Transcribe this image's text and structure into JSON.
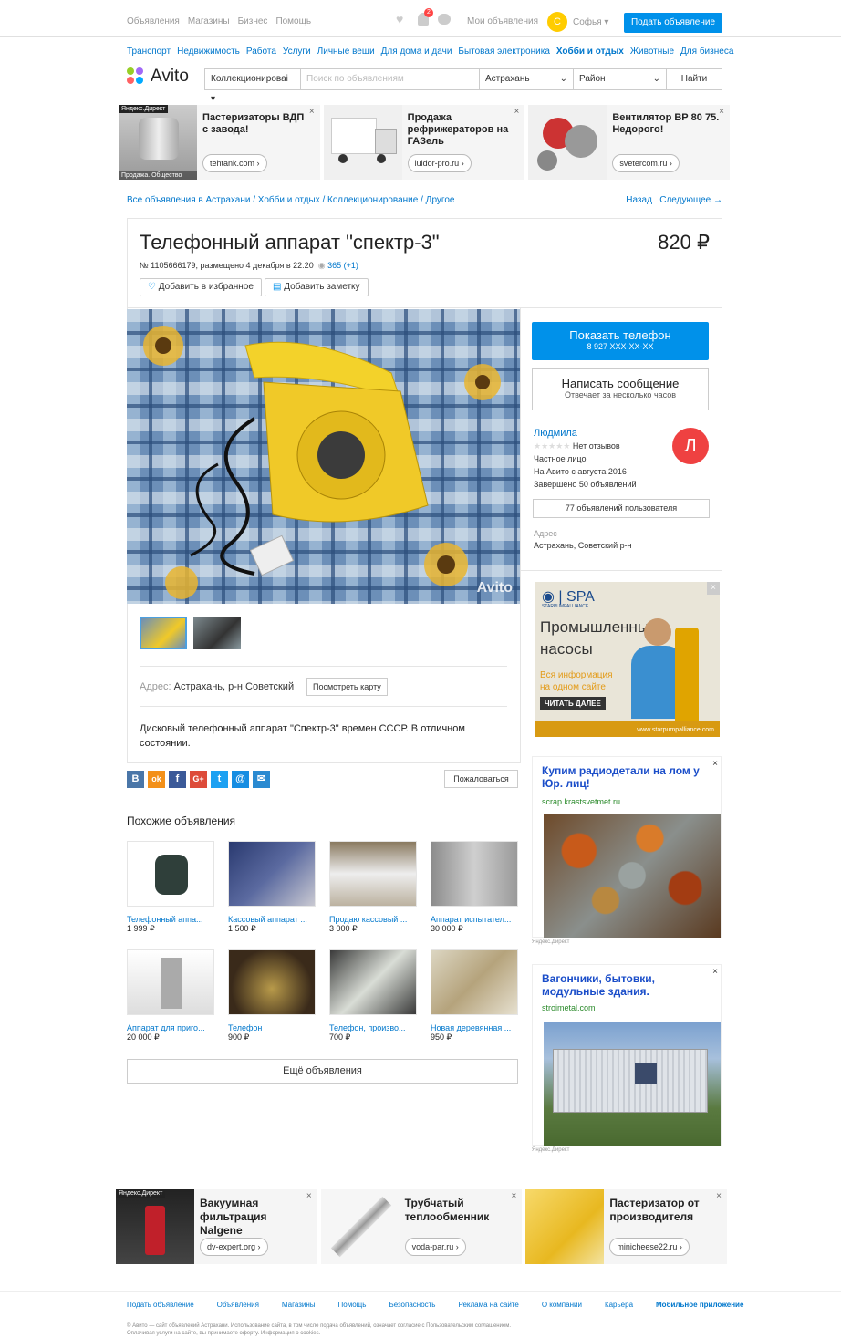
{
  "topbar": {
    "nav": [
      "Объявления",
      "Магазины",
      "Бизнес",
      "Помощь"
    ],
    "notif_count": "2",
    "my_ads": "Мои объявления",
    "user_initial": "С",
    "user_name": "Софья ▾",
    "post_ad": "Подать объявление"
  },
  "categories": [
    "Транспорт",
    "Недвижимость",
    "Работа",
    "Услуги",
    "Личные вещи",
    "Для дома и дачи",
    "Бытовая электроника",
    "Хобби и отдых",
    "Животные",
    "Для бизнеса"
  ],
  "logo": "Avito",
  "search": {
    "category": "Коллекционироваі ▾",
    "placeholder": "Поиск по объявлениям",
    "city": "Астрахань",
    "district": "Район",
    "button": "Найти"
  },
  "ads_top": [
    {
      "title": "Пастеризаторы ВДП с завода!",
      "url": "tehtank.com ›",
      "badge": "Яндекс.Директ",
      "caption": "Продажа. Общество",
      "close": "×"
    },
    {
      "title": "Продажа рефрижераторов на ГАЗель",
      "url": "luidor-pro.ru ›",
      "close": "×"
    },
    {
      "title": "Вентилятор ВР 80 75. Недорого!",
      "url": "svetercom.ru ›",
      "close": "×"
    }
  ],
  "breadcrumb": "Все объявления в Астрахани / Хобби и отдых / Коллекционирование / Другое",
  "pager": {
    "back": "Назад",
    "next": "Следующее →"
  },
  "listing": {
    "title": "Телефонный аппарат \"спектр-3\"",
    "price": "820 ₽",
    "meta": "№ 1105666179, размещено 4 декабря в 22:20",
    "views": "365 (+1)",
    "add_fav": "Добавить в избранное",
    "add_note": "Добавить заметку",
    "watermark": "Avito",
    "address_label": "Адрес:",
    "address": "Астрахань, р-н Советский",
    "map_button": "Посмотреть карту",
    "description": "Дисковый телефонный аппарат \"Спектр-3\" времен СССР. В отличном состоянии."
  },
  "contact": {
    "show_phone": "Показать телефон",
    "phone": "8 927 XXX-XX-XX",
    "write": "Написать сообщение",
    "write_sub": "Отвечает за несколько часов"
  },
  "seller": {
    "name": "Людмила",
    "initial": "Л",
    "stars": "★★★★★",
    "reviews": "Нет отзывов",
    "type": "Частное лицо",
    "since": "На Авито с августа 2016",
    "done": "Завершено 50 объявлений",
    "all_ads": "77 объявлений пользователя",
    "address_label": "Адрес",
    "address": "Астрахань, Советский р-н"
  },
  "social": {
    "icons": [
      "В",
      "ok",
      "f",
      "G+",
      "t",
      "@",
      "✉"
    ],
    "complain": "Пожаловаться"
  },
  "similar": {
    "heading": "Похожие объявления",
    "items": [
      {
        "title": "Телефонный аппа...",
        "price": "1 999 ₽"
      },
      {
        "title": "Кассовый аппарат ...",
        "price": "1 500 ₽"
      },
      {
        "title": "Продаю кассовый ...",
        "price": "3 000 ₽"
      },
      {
        "title": "Аппарат испытател...",
        "price": "30 000 ₽"
      },
      {
        "title": "Аппарат для приго...",
        "price": "20 000 ₽"
      },
      {
        "title": "Телефон",
        "price": "900 ₽"
      },
      {
        "title": "Телефон, произво...",
        "price": "700 ₽"
      },
      {
        "title": "Новая деревянная ...",
        "price": "950 ₽"
      }
    ],
    "more": "Ещё объявления"
  },
  "right_ads": {
    "spa": {
      "brand": "SPA",
      "brand_sub": "STARPUMPALLIANCE",
      "headline": "Промышленные насосы",
      "sub": "Вся информация на одном сайте",
      "cta": "ЧИТАТЬ ДАЛЕЕ",
      "site": "www.starpumpalliance.com",
      "close": "×"
    },
    "radio": {
      "title": "Купим радиодетали на лом у Юр. лиц!",
      "url": "scrap.krastsvetmet.ru",
      "label": "Яндекс.Директ",
      "close": "×"
    },
    "wagons": {
      "title": "Вагончики, бытовки, модульные здания.",
      "url": "stroimetal.com",
      "label": "Яндекс.Директ",
      "close": "×"
    }
  },
  "ads_bottom": [
    {
      "title": "Вакуумная фильтрация Nalgene",
      "url": "dv-expert.org ›",
      "badge": "Яндекс.Директ",
      "close": "×"
    },
    {
      "title": "Трубчатый теплообменник",
      "url": "voda-par.ru ›",
      "close": "×"
    },
    {
      "title": "Пастеризатор от производителя",
      "url": "minicheese22.ru ›",
      "close": "×"
    }
  ],
  "footer": {
    "links": [
      "Подать объявление",
      "Объявления",
      "Магазины",
      "Помощь",
      "Безопасность",
      "Реклама на сайте",
      "О компании",
      "Карьера",
      "Мобильное приложение"
    ],
    "copy1": "© Авито — сайт объявлений Астрахани. Использование сайта, в том числе подача объявлений, означает согласие с Пользовательским соглашением.",
    "copy2": "Оплачивая услуги на сайте, вы принимаете оферту. Информация о cookies."
  },
  "colors": {
    "accent": "#0091ea",
    "link": "#0077cc",
    "avatar_user": "#ffcc00",
    "avatar_seller": "#ef4141"
  }
}
